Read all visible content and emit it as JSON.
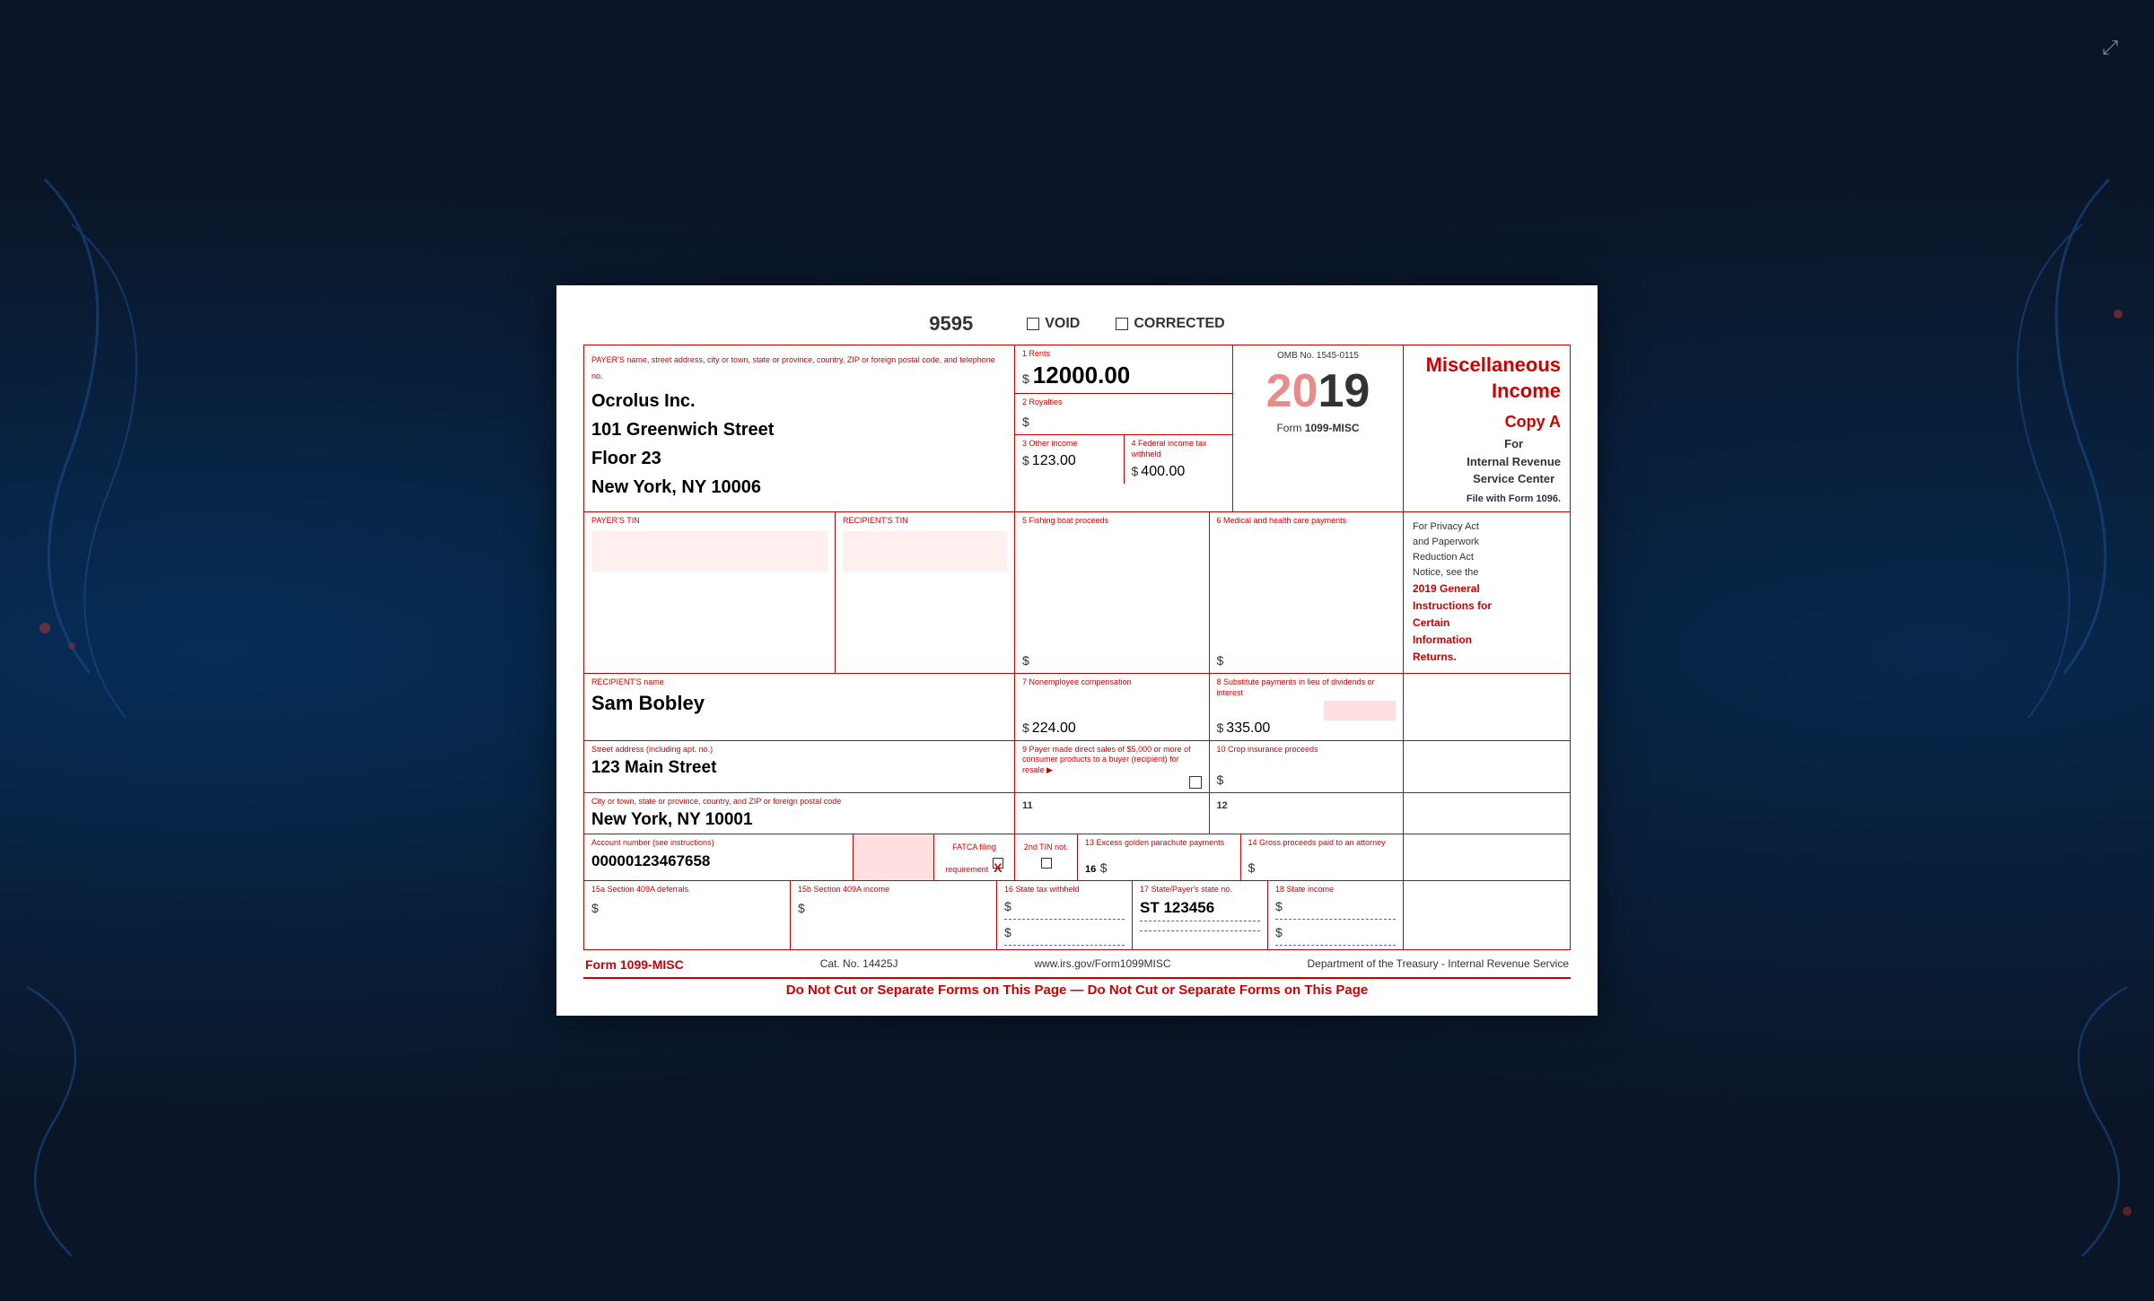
{
  "background": {
    "color": "#0a1628"
  },
  "form_number_line": {
    "form_number": "9595",
    "void_label": "VOID",
    "corrected_label": "CORRECTED"
  },
  "payer": {
    "label": "PAYER'S name, street address, city or town, state or province, country, ZIP or foreign postal code, and telephone no.",
    "name": "Ocrolus Inc.",
    "address1": "101 Greenwich Street",
    "address2": "Floor 23",
    "address3": "New York, NY 10006"
  },
  "field1": {
    "label": "1 Rents",
    "value": "12000.00",
    "dollar": "$"
  },
  "omb": {
    "label": "OMB No. 1545-0115",
    "year": "20",
    "year_bold": "19",
    "form_label": "Form",
    "form_name": "1099-MISC"
  },
  "misc_income": {
    "title": "Miscellaneous\nIncome",
    "copy_label": "Copy A",
    "for_label": "For",
    "irs_label": "Internal Revenue\nService Center",
    "file_label": "File with Form 1096."
  },
  "field2": {
    "label": "2 Royalties",
    "dollar": "$"
  },
  "field3": {
    "label": "3 Other income",
    "value": "123.00",
    "dollar": "$"
  },
  "field4": {
    "label": "4 Federal income tax withheld",
    "value": "400.00",
    "dollar": "$"
  },
  "payer_tin": {
    "label": "PAYER'S TIN"
  },
  "recipient_tin": {
    "label": "RECIPIENT'S TIN"
  },
  "field5": {
    "label": "5 Fishing boat proceeds",
    "dollar": "$"
  },
  "field6": {
    "label": "6 Medical and health care payments",
    "dollar": "$"
  },
  "recipient": {
    "label": "RECIPIENT'S name",
    "name": "Sam Bobley"
  },
  "field7": {
    "label": "7 Nonemployee compensation",
    "value": "224.00",
    "dollar": "$"
  },
  "field8": {
    "label": "8 Substitute payments in lieu of dividends or interest",
    "value": "335.00",
    "dollar": "$"
  },
  "street_address": {
    "label": "Street address (including apt. no.)",
    "value": "123 Main Street"
  },
  "field9": {
    "label": "9 Payer made direct sales of $5,000 or more of consumer products to a buyer (recipient) for resale ▶"
  },
  "field10": {
    "label": "10 Crop insurance proceeds",
    "dollar": "$"
  },
  "city_state": {
    "label": "City or town, state or province, country, and ZIP or foreign postal code",
    "value": "New York, NY 10001"
  },
  "field11": {
    "label": "11"
  },
  "field12": {
    "label": "12"
  },
  "privacy_notice": {
    "text1": "For Privacy Act\nand Paperwork\nReduction Act\nNotice, see the",
    "text2": "2019 General\nInstructions for\nCertain\nInformation\nReturns."
  },
  "account_number": {
    "label": "Account number (see instructions)",
    "value": "00000123467658"
  },
  "fatca": {
    "label": "FATCA filing\nrequirement"
  },
  "field2nd_tin": {
    "label": "2nd TIN not."
  },
  "field13": {
    "label": "13 Excess golden parachute\npayments",
    "number": "16",
    "dollar": "$"
  },
  "field14": {
    "label": "14 Gross proceeds paid to an attorney",
    "dollar": "$"
  },
  "field15a": {
    "label": "15a Section 409A deferrals",
    "dollar": "$"
  },
  "field15b": {
    "label": "15b Section 409A income",
    "dollar": "$"
  },
  "field16": {
    "label": "16 State tax withheld",
    "dollar1": "$",
    "dollar2": "$"
  },
  "field17": {
    "label": "17 State/Payer's state no.",
    "value": "ST 123456"
  },
  "field18": {
    "label": "18 State income",
    "dollar1": "$",
    "dollar2": "$"
  },
  "footer": {
    "form_label": "Form 1099-MISC",
    "cat_label": "Cat. No. 14425J",
    "website": "www.irs.gov/Form1099MISC",
    "dept": "Department of the Treasury - Internal Revenue Service",
    "do_not_cut": "Do Not Cut or Separate Forms on This Page — Do Not Cut or Separate Forms on This Page"
  }
}
